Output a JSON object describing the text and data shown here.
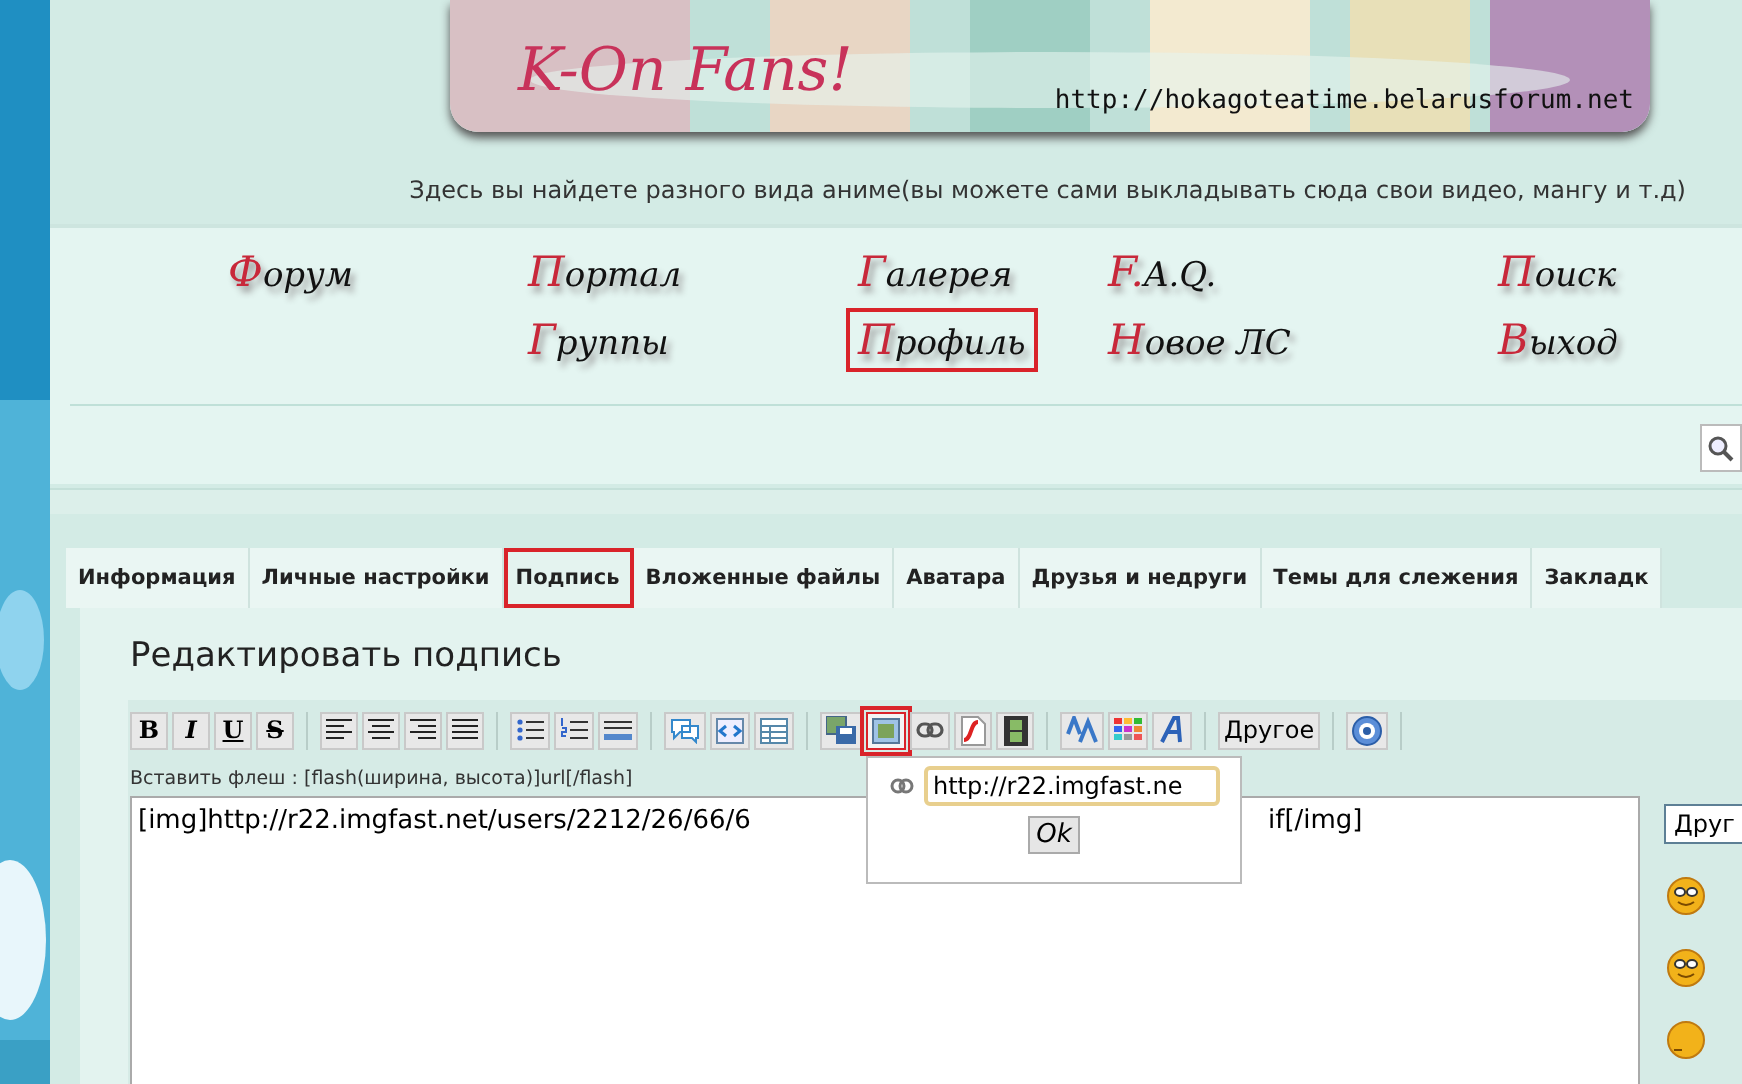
{
  "banner": {
    "logo": "K-On Fans!",
    "url": "http://hokagoteatime.belarusforum.net"
  },
  "tagline": "Здесь вы найдете разного вида аниме(вы можете сами выкладывать сюда свои видео, мангу и т.д)",
  "nav": {
    "columns": [
      {
        "items": [
          {
            "label": "Форум",
            "highlighted": false
          }
        ]
      },
      {
        "items": [
          {
            "label": "Портал",
            "highlighted": false
          },
          {
            "label": "Группы",
            "highlighted": false
          }
        ]
      },
      {
        "items": [
          {
            "label": "Галерея",
            "highlighted": false
          },
          {
            "label": "Профиль",
            "highlighted": true
          }
        ]
      },
      {
        "items": [
          {
            "label": "F.A.Q.",
            "highlighted": false
          },
          {
            "label": "Новое ЛС",
            "highlighted": false
          }
        ]
      },
      {
        "items": [
          {
            "label": "Поиск",
            "highlighted": false
          },
          {
            "label": "Выход",
            "highlighted": false
          }
        ]
      }
    ]
  },
  "tabs": [
    {
      "label": "Информация",
      "selected": false
    },
    {
      "label": "Личные настройки",
      "selected": false
    },
    {
      "label": "Подпись",
      "selected": true
    },
    {
      "label": "Вложенные файлы",
      "selected": false
    },
    {
      "label": "Аватара",
      "selected": false
    },
    {
      "label": "Друзья и недруги",
      "selected": false
    },
    {
      "label": "Темы для слежения",
      "selected": false
    },
    {
      "label": "Закладк",
      "selected": false
    }
  ],
  "page_title": "Редактировать подпись",
  "toolbar": [
    [
      {
        "kind": "text",
        "label": "B",
        "highlighted": false
      },
      {
        "kind": "text",
        "label": "I",
        "highlighted": false
      },
      {
        "kind": "text",
        "label": "U",
        "highlighted": false
      },
      {
        "kind": "text",
        "label": "S",
        "highlighted": false
      }
    ],
    [
      {
        "kind": "icon",
        "highlighted": false
      },
      {
        "kind": "icon",
        "highlighted": false
      },
      {
        "kind": "icon",
        "highlighted": false
      },
      {
        "kind": "icon",
        "highlighted": false
      }
    ],
    [
      {
        "kind": "icon",
        "highlighted": false
      },
      {
        "kind": "icon",
        "highlighted": false
      },
      {
        "kind": "icon",
        "highlighted": false
      }
    ],
    [
      {
        "kind": "icon",
        "highlighted": false
      },
      {
        "kind": "icon",
        "highlighted": false
      },
      {
        "kind": "icon",
        "highlighted": false
      }
    ],
    [
      {
        "kind": "icon",
        "highlighted": false
      },
      {
        "kind": "icon",
        "highlighted": true
      },
      {
        "kind": "icon",
        "highlighted": false
      },
      {
        "kind": "icon",
        "highlighted": false
      },
      {
        "kind": "icon",
        "highlighted": false
      }
    ],
    [
      {
        "kind": "icon",
        "highlighted": false
      },
      {
        "kind": "icon",
        "highlighted": false
      },
      {
        "kind": "icon",
        "highlighted": false
      }
    ],
    [
      {
        "kind": "text",
        "label": "Другое",
        "highlighted": false
      }
    ],
    [
      {
        "kind": "icon",
        "highlighted": false
      }
    ]
  ],
  "hint": "Вставить флеш : [flash(ширина, высота)]url[/flash]",
  "editor": {
    "text_start": "[img]http://r22.imgfast.net/users/2212/26/66/6",
    "text_end": "if[/img]"
  },
  "popup": {
    "value": "http://r22.imgfast.ne",
    "button": "Ok"
  },
  "side": {
    "select": "Друг"
  }
}
